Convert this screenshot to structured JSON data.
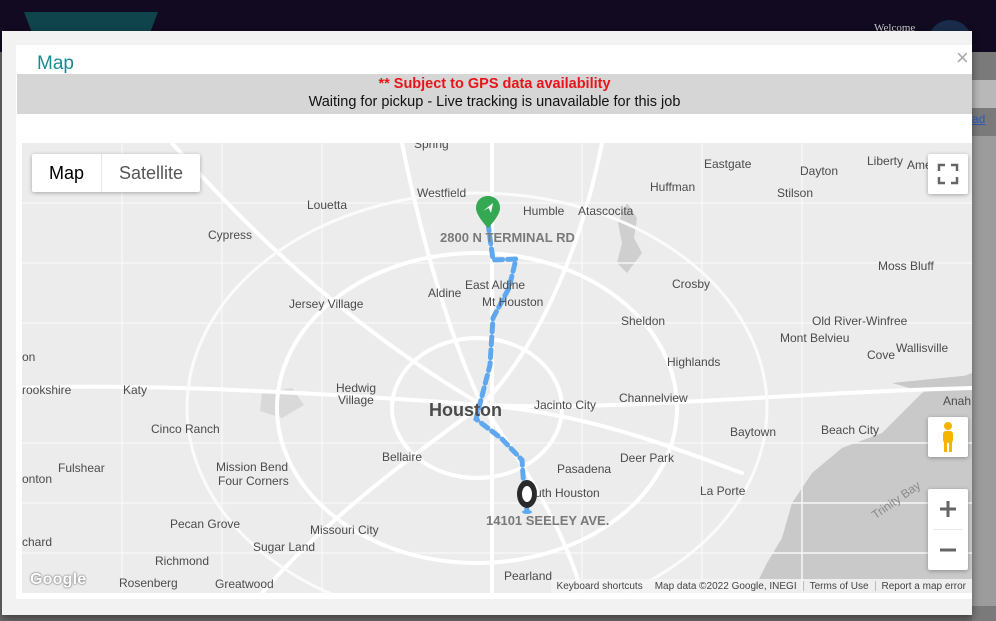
{
  "background": {
    "welcome_text": "Welcome",
    "side_link": "ad"
  },
  "modal": {
    "title": "Map",
    "close_label": "×",
    "notice_warning": "** Subject to GPS data availability",
    "notice_status": "Waiting for pickup - Live tracking is unavailable for this job"
  },
  "map": {
    "type_options": [
      "Map",
      "Satellite"
    ],
    "selected_type": "Map",
    "labels": {
      "spring": "Spring",
      "eastgate": "Eastgate",
      "liberty": "Liberty",
      "ame": "Ame",
      "dayton": "Dayton",
      "westfield": "Westfield",
      "huffman": "Huffman",
      "stilson": "Stilson",
      "louetta": "Louetta",
      "humble": "Humble",
      "atascocita": "Atascocita",
      "cypress": "Cypress",
      "moss_bluff": "Moss Bluff",
      "east_aldine": "East Aldine",
      "aldine": "Aldine",
      "mt_houston": "Mt Houston",
      "crosby": "Crosby",
      "jersey_village": "Jersey Village",
      "sheldon": "Sheldon",
      "old_river": "Old River-Winfree",
      "mont_belvieu": "Mont Belvieu",
      "wallisville": "Wallisville",
      "cove": "Cove",
      "on": "on",
      "highlands": "Highlands",
      "brookshire": "rookshire",
      "katy": "Katy",
      "hedwig": "Hedwig",
      "hedwig2": "Village",
      "houston": "Houston",
      "jacinto": "Jacinto City",
      "channelview": "Channelview",
      "anah": "Anah",
      "cinco": "Cinco Ranch",
      "baytown": "Baytown",
      "beach_city": "Beach City",
      "bellaire": "Bellaire",
      "deer_park": "Deer Park",
      "fulshear": "Fulshear",
      "mission": "Mission Bend",
      "mission2": "Four Corners",
      "pasadena": "Pasadena",
      "onton": "onton",
      "south_houston": "uth Houston",
      "la_porte": "La Porte",
      "trinity_bay": "Trinity Bay",
      "pecan": "Pecan Grove",
      "missouri": "Missouri City",
      "chard": "chard",
      "sugar": "Sugar Land",
      "richmond": "Richmond",
      "pearland": "Pearland",
      "rosenberg": "Rosenberg",
      "greatwood": "Greatwood"
    },
    "pickup_address": "2800 N TERMINAL RD",
    "dropoff_address": "14101 SEELEY AVE.",
    "google_logo": "Google",
    "footer": [
      "Keyboard shortcuts",
      "Map data ©2022 Google, INEGI",
      "Terms of Use",
      "Report a map error"
    ],
    "colors": {
      "route": "#5fa8ef",
      "pickup_marker": "#34a853",
      "dropoff_marker": "#2a2a2a",
      "water": "#c9c9c9",
      "highway": "#ffffff"
    },
    "icons": {
      "fullscreen": "fullscreen-icon",
      "pegman": "pegman-icon",
      "zoom_in": "plus-icon",
      "zoom_out": "minus-icon",
      "pickup": "airplane-pin-icon",
      "dropoff": "destination-pin-icon"
    }
  }
}
